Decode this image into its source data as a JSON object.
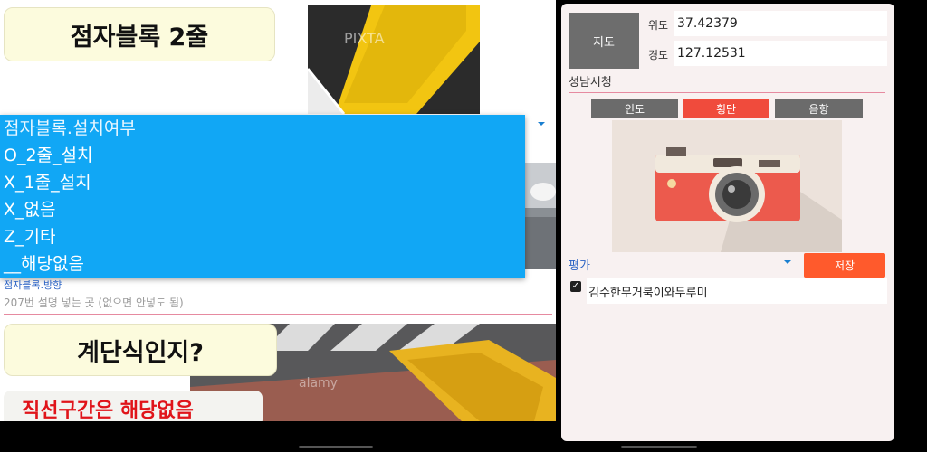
{
  "left": {
    "title1": "점자블록 2줄",
    "title2": "계단식인지?",
    "red_note": "직선구간은 해당없음",
    "dropdown": {
      "header": "점자블록.설치여부",
      "options": [
        "O_2줄_설치",
        "X_1줄_설치",
        "X_없음",
        "Z_기타",
        "__해당없음"
      ]
    },
    "behind_label": "점자블록.방향",
    "field_placeholder": "207번 설명 넣는 곳 (없으면 안넣도 됨)",
    "watermark1": "PIXTA",
    "watermark2": "alamy"
  },
  "right": {
    "map_button": "지도",
    "lat_label": "위도",
    "lat_value": "37.42379",
    "lng_label": "경도",
    "lng_value": "127.12531",
    "place": "성남시청",
    "tabs": [
      "인도",
      "횡단",
      "음향"
    ],
    "eval_label": "평가",
    "save_button": "저장",
    "checkbox_mark": "✓",
    "name_value": "김수한무거북이와두루미"
  },
  "colors": {
    "dropdown_bg": "#11a7f5",
    "accent_red": "#f04b3c",
    "save_orange": "#ff5a2c",
    "title_card_bg": "#fcfbdd",
    "red_text": "#e0141a"
  }
}
